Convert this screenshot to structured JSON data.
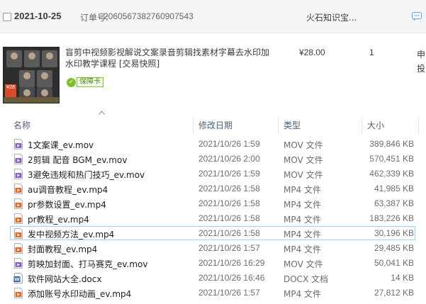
{
  "order": {
    "date": "2021-10-25",
    "order_label": "订单号:",
    "order_number": "2060567382760907543",
    "shop_name": "火石知识宝...",
    "product_title": "盲剪中视频影视解说文案录音剪辑找素材字幕去水印加水印教学课程 [交易快照]",
    "guarantee_label": "保障卡",
    "price": "¥28.00",
    "quantity": "1",
    "side_text": "申投",
    "thumb_price": "¥28"
  },
  "explorer": {
    "columns": {
      "name": "名称",
      "date": "修改日期",
      "type": "类型",
      "size": "大小"
    },
    "files": [
      {
        "name": "1文案课_ev.mov",
        "date": "2021/10/26 1:59",
        "type": "MOV 文件",
        "size": "389,846 KB",
        "kind": "video"
      },
      {
        "name": "2剪辑 配音 BGM_ev.mov",
        "date": "2021/10/26 2:00",
        "type": "MOV 文件",
        "size": "570,451 KB",
        "kind": "video"
      },
      {
        "name": "3避免违规和热门技巧_ev.mov",
        "date": "2021/10/26 1:59",
        "type": "MOV 文件",
        "size": "462,339 KB",
        "kind": "video"
      },
      {
        "name": "au调音教程_ev.mp4",
        "date": "2021/10/26 1:58",
        "type": "MP4 文件",
        "size": "41,985 KB",
        "kind": "mp4"
      },
      {
        "name": "pr参数设置_ev.mp4",
        "date": "2021/10/26 1:58",
        "type": "MP4 文件",
        "size": "63,387 KB",
        "kind": "mp4"
      },
      {
        "name": "pr教程_ev.mp4",
        "date": "2021/10/26 1:58",
        "type": "MP4 文件",
        "size": "183,226 KB",
        "kind": "mp4"
      },
      {
        "name": "发中视频方法_ev.mp4",
        "date": "2021/10/26 1:58",
        "type": "MP4 文件",
        "size": "30,196 KB",
        "kind": "mp4"
      },
      {
        "name": "封面教程_ev.mp4",
        "date": "2021/10/26 1:57",
        "type": "MP4 文件",
        "size": "29,485 KB",
        "kind": "mp4"
      },
      {
        "name": "剪映加封面、打马赛克_ev.mov",
        "date": "2021/10/26 16:29",
        "type": "MOV 文件",
        "size": "50,041 KB",
        "kind": "video"
      },
      {
        "name": "软件网站大全.docx",
        "date": "2021/10/26 16:46",
        "type": "DOCX 文档",
        "size": "14 KB",
        "kind": "docx"
      },
      {
        "name": "添加账号水印动画_ev.mp4",
        "date": "2021/10/26 1:57",
        "type": "MP4 文件",
        "size": "27,812 KB",
        "kind": "mp4"
      }
    ],
    "selected_index": 6
  },
  "colors": {
    "header_text": "#4c607a",
    "selection_border": "#99d1ff",
    "guarantee_green": "#7dbf2a",
    "mp4_icon": "#e06c2c",
    "video_icon": "#8a63c8",
    "docx_icon": "#2b5797"
  }
}
